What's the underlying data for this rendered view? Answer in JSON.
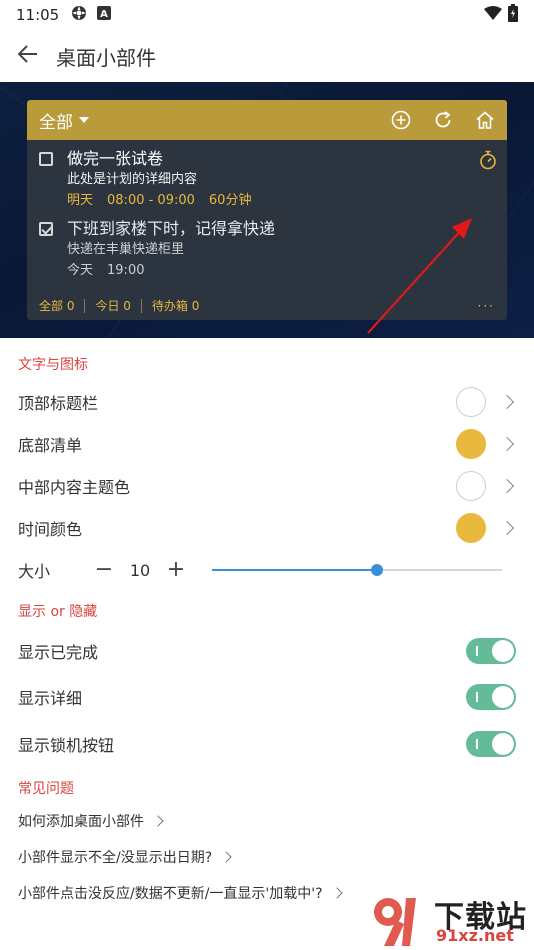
{
  "status_bar": {
    "time": "11:05",
    "icons": [
      "settings-icon",
      "a-badge-icon",
      "wifi-icon",
      "battery-icon"
    ]
  },
  "app_bar": {
    "title": "桌面小部件",
    "back_icon": "back-arrow-icon"
  },
  "widget": {
    "filter_label": "全部",
    "header_color": "#b99b3c",
    "body_color": "#2c3440",
    "tasks": [
      {
        "title": "做完一张试卷",
        "detail": "此处是计划的详细内容",
        "day": "明天",
        "time": "08:00 - 09:00",
        "duration": "60分钟",
        "done": false
      },
      {
        "title": "下班到家楼下时，记得拿快递",
        "detail": "快递在丰巢快递柜里",
        "day": "今天",
        "time": "19:00",
        "duration": "",
        "done": true
      }
    ],
    "footer": {
      "all": "全部 0",
      "today": "今日 0",
      "inbox": "待办箱 0",
      "more": "···"
    }
  },
  "sections": {
    "text_icon": {
      "title": "文字与图标",
      "rows": [
        {
          "label": "顶部标题栏",
          "color": "#ffffff"
        },
        {
          "label": "底部清单",
          "color": "#e8b93e"
        },
        {
          "label": "中部内容主题色",
          "color": "#ffffff"
        },
        {
          "label": "时间颜色",
          "color": "#e8b93e"
        }
      ],
      "size": {
        "label": "大小",
        "value": "10",
        "minus": "−",
        "plus": "+",
        "slider_fraction": 0.57
      }
    },
    "show_hide": {
      "title": "显示 or 隐藏",
      "toggles": [
        {
          "label": "显示已完成",
          "on": true
        },
        {
          "label": "显示详细",
          "on": true
        },
        {
          "label": "显示锁机按钮",
          "on": true
        }
      ]
    },
    "faq": {
      "title": "常见问题",
      "items": [
        "如何添加桌面小部件",
        "小部件显示不全/没显示出日期?",
        "小部件点击没反应/数据不更新/一直显示'加载中'?"
      ]
    }
  },
  "watermark": {
    "text": "下载站",
    "url": "91xz.net"
  },
  "colors": {
    "accent_red": "#d9443f",
    "toggle_green": "#63bb98",
    "slider_blue": "#3a8fdc",
    "gold": "#e6b83e"
  }
}
